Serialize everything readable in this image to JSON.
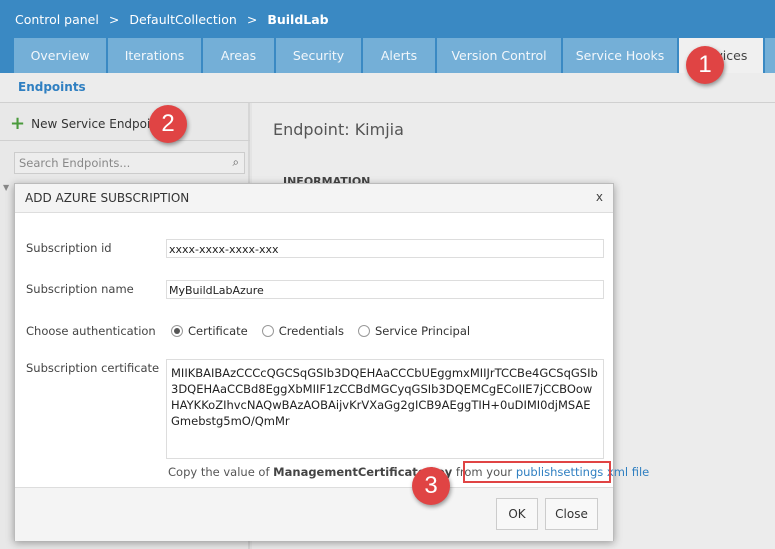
{
  "breadcrumb": [
    "Control panel",
    ">",
    "DefaultCollection",
    ">",
    "BuildLab"
  ],
  "tabs": [
    "Overview",
    "Iterations",
    "Areas",
    "Security",
    "Alerts",
    "Version Control",
    "Service Hooks",
    "Services"
  ],
  "subnav": "Endpoints",
  "left": {
    "new_endpoint": "New Service Endpoint",
    "search_placeholder": "Search Endpoints..."
  },
  "right": {
    "title": "Endpoint: Kimjia",
    "section": "INFORMATION"
  },
  "dialog": {
    "title": "ADD AZURE SUBSCRIPTION",
    "close": "x",
    "sub_id_label": "Subscription id",
    "sub_id": "xxxx-xxxx-xxxx-xxx",
    "sub_name_label": "Subscription name",
    "sub_name": "MyBuildLabAzure",
    "auth_label": "Choose authentication",
    "auth_options": [
      "Certificate",
      "Credentials",
      "Service Principal"
    ],
    "auth_selected": "Certificate",
    "cert_label": "Subscription certificate",
    "cert_value": "MIIKBAIBAzCCCcQGCSqGSIb3DQEHAaCCCbUEggmxMIIJrTCCBe4GCSqGSIb3DQEHAaCCBd8EggXbMIIF1zCCBdMGCyqGSIb3DQEMCgECoIIE7jCCBOowHAYKKoZIhvcNAQwBAzAOBAijvKrVXaGg2gICB9AEggTIH+0uDIMI0djMSAEGmebstg5mO/QmMr",
    "hint_prefix": "Copy the value of ",
    "hint_key": "ManagementCertificate key",
    "hint_mid": " from your ",
    "hint_link": "publishsettings xml file",
    "ok": "OK",
    "cancel": "Close"
  },
  "annotations": [
    "1",
    "2",
    "3"
  ],
  "colors": {
    "header": "#3a89c3",
    "tab": "#74afd7",
    "link": "#2f7fc1",
    "badge": "#e04444"
  }
}
